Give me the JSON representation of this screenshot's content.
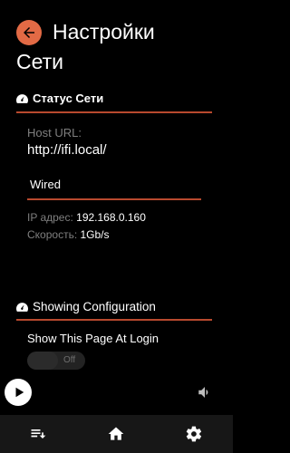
{
  "header": {
    "title_line1": "Настройки",
    "title_line2": "Сети"
  },
  "network_status": {
    "section_title": "Статус Сети",
    "host_url_label": "Host URL:",
    "host_url_value": "http://ifi.local/",
    "connection_type": "Wired",
    "ip_label": "IP адрес:",
    "ip_value": "192.168.0.160",
    "speed_label": "Скорость:",
    "speed_value": "1Gb/s"
  },
  "showing_configuration": {
    "section_title": "Showing Configuration",
    "login_label": "Show This Page At Login",
    "toggle_state": "Off"
  },
  "colors": {
    "accent": "#e26a45",
    "divider": "#b8492e",
    "background": "#000000",
    "nav_background": "#171717"
  },
  "icons": {
    "back": "back-arrow-icon",
    "section": "gauge-icon",
    "play": "play-icon",
    "volume": "volume-icon",
    "queue": "queue-icon",
    "home": "home-icon",
    "settings": "gear-icon"
  }
}
